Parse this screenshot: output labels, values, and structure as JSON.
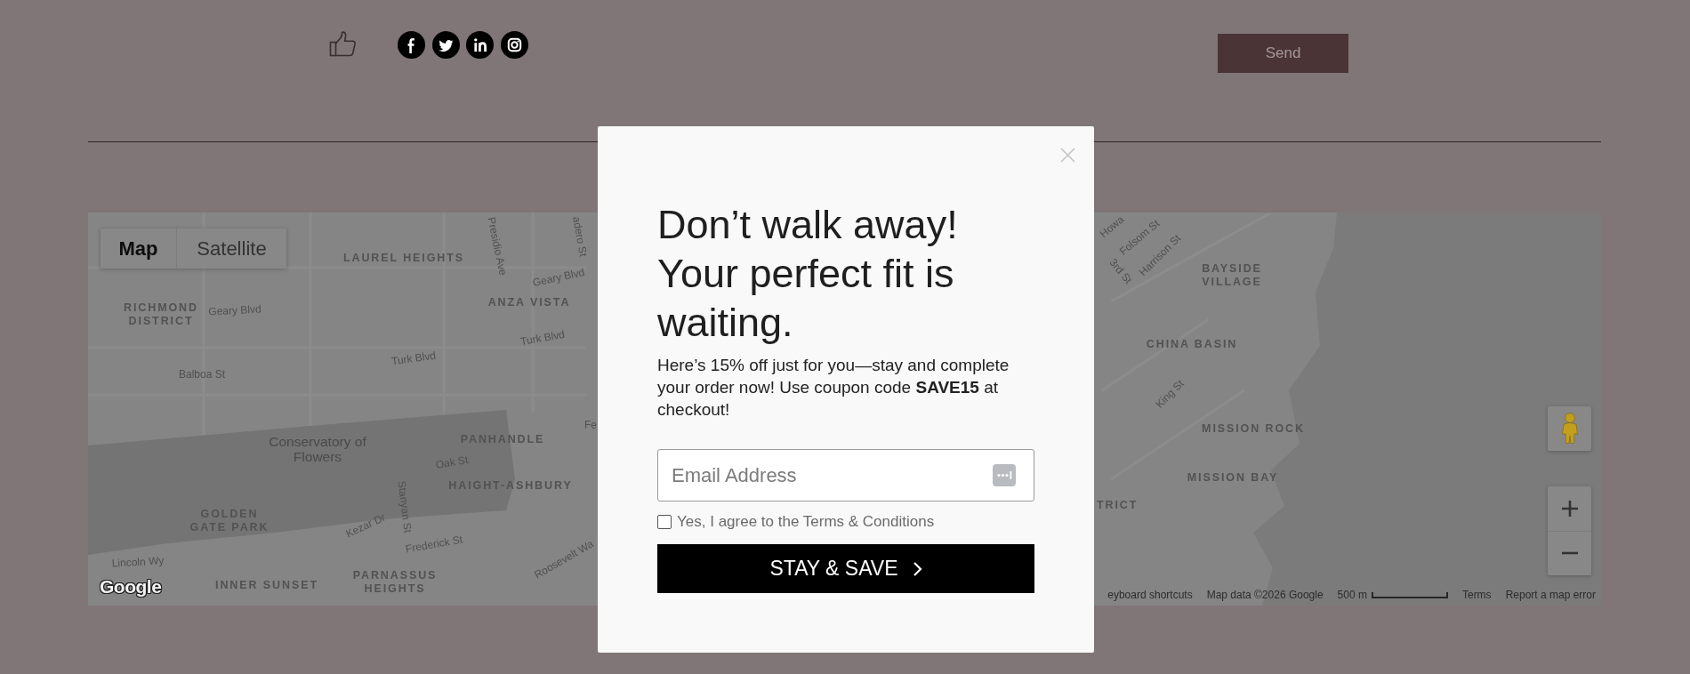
{
  "header": {
    "send_button": "Send"
  },
  "map": {
    "map_type_tabs": [
      {
        "label": "Map",
        "selected": true
      },
      {
        "label": "Satellite",
        "selected": false
      }
    ],
    "labels": [
      {
        "text": "LAUREL HEIGHTS",
        "kind": "area"
      },
      {
        "text": "Presidio Ave",
        "kind": "street"
      },
      {
        "text": "adero St",
        "kind": "street"
      },
      {
        "text": "Geary Blvd",
        "kind": "street"
      },
      {
        "text": "ANZA VISTA",
        "kind": "area"
      },
      {
        "text": "RICHMOND DISTRICT",
        "kind": "area"
      },
      {
        "text": "Geary Blvd",
        "kind": "street"
      },
      {
        "text": "Turk Blvd",
        "kind": "street"
      },
      {
        "text": "Turk Blvd",
        "kind": "street"
      },
      {
        "text": "Balboa St",
        "kind": "street"
      },
      {
        "text": "Conservatory of Flowers",
        "kind": "place"
      },
      {
        "text": "PANHANDLE",
        "kind": "area"
      },
      {
        "text": "Fe",
        "kind": "street"
      },
      {
        "text": "Oak St",
        "kind": "street"
      },
      {
        "text": "HAIGHT-ASHBURY",
        "kind": "area"
      },
      {
        "text": "Stanyan St",
        "kind": "street"
      },
      {
        "text": "GOLDEN GATE PARK",
        "kind": "area"
      },
      {
        "text": "Kezar Dr",
        "kind": "street"
      },
      {
        "text": "Frederick St",
        "kind": "street"
      },
      {
        "text": "Lincoln Wy",
        "kind": "street"
      },
      {
        "text": "INNER SUNSET",
        "kind": "area"
      },
      {
        "text": "PARNASSUS HEIGHTS",
        "kind": "area"
      },
      {
        "text": "Roosevelt Wa",
        "kind": "street"
      },
      {
        "text": "Howa",
        "kind": "street"
      },
      {
        "text": "Folsom St",
        "kind": "street"
      },
      {
        "text": "3rd St",
        "kind": "street"
      },
      {
        "text": "Harrison St",
        "kind": "street"
      },
      {
        "text": "BAYSIDE VILLAGE",
        "kind": "area"
      },
      {
        "text": "CHINA BASIN",
        "kind": "area"
      },
      {
        "text": "King St",
        "kind": "street"
      },
      {
        "text": "MISSION ROCK",
        "kind": "area"
      },
      {
        "text": "MISSION BAY",
        "kind": "area"
      },
      {
        "text": "TRICT",
        "kind": "area"
      }
    ],
    "logo": "Google",
    "attribution": {
      "shortcuts_link": "eyboard shortcuts",
      "map_data": "Map data ©2026 Google",
      "scale": "500 m",
      "terms_link": "Terms",
      "report_link": "Report a map error"
    }
  },
  "popup": {
    "heading": "Don’t walk away! Your perfect fit is waiting.",
    "body": "Here’s 15% off just for you—stay and complete your order now! Use coupon code **SAVE15** at checkout!",
    "email_field": {
      "placeholder": "Email Address"
    },
    "terms": {
      "label": "Yes, I agree to the Terms & Conditions",
      "checked": false
    },
    "submit_button": "STAY & SAVE"
  }
}
